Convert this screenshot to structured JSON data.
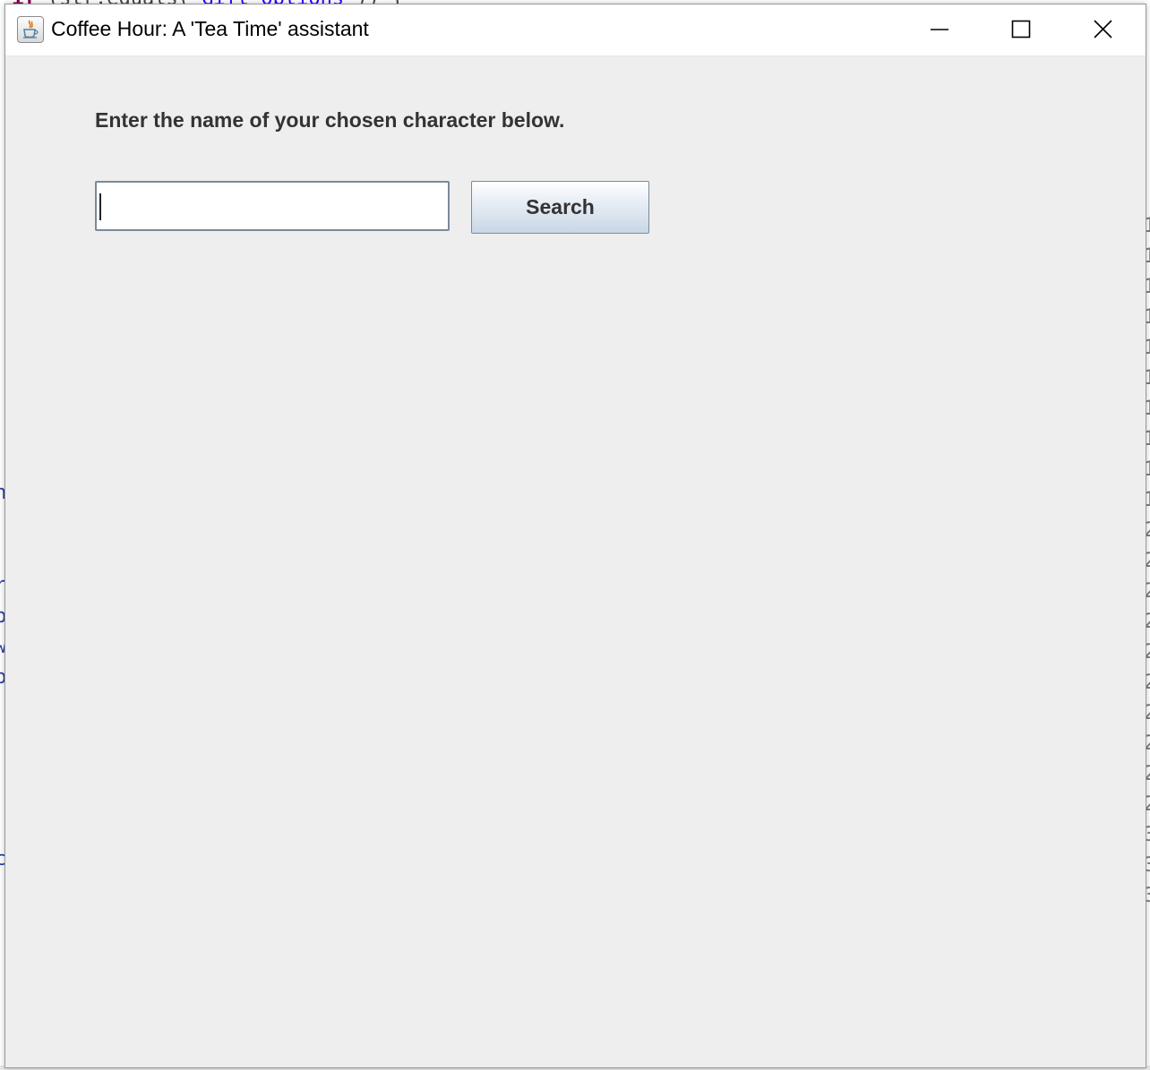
{
  "window": {
    "title": "Coffee Hour: A 'Tea Time' assistant",
    "controls": {
      "minimize": "minimize-icon",
      "maximize": "maximize-icon",
      "close": "close-icon"
    }
  },
  "main": {
    "prompt": "Enter the name of your chosen character below.",
    "search_input": {
      "value": "",
      "placeholder": ""
    },
    "search_button_label": "Search"
  },
  "colors": {
    "content_bg": "#eeeeee",
    "text": "#333333",
    "button_gradient_bottom": "#c9d6e6"
  }
}
